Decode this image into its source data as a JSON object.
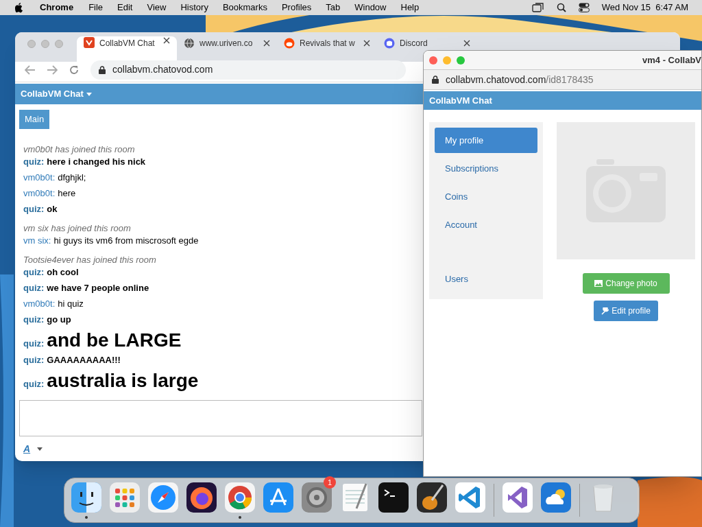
{
  "menu_bar": {
    "app": "Chrome",
    "items": [
      "File",
      "Edit",
      "View",
      "History",
      "Bookmarks",
      "Profiles",
      "Tab",
      "Window",
      "Help"
    ],
    "clock": "Wed Nov 15  6:47 AM"
  },
  "browser": {
    "tabs": [
      {
        "title": "CollabVM Chat",
        "selected": true,
        "kind": "collabvm"
      },
      {
        "title": "www.uriven.co",
        "selected": false,
        "kind": "globe"
      },
      {
        "title": "Revivals that w",
        "selected": false,
        "kind": "reddit"
      },
      {
        "title": "Discord",
        "selected": false,
        "kind": "discord"
      }
    ],
    "url": "collabvm.chatovod.com"
  },
  "chat": {
    "title": "CollabVM Chat",
    "room_tab": "Main",
    "messages": [
      {
        "kind": "system",
        "text": "vm0b0t has joined this room"
      },
      {
        "kind": "chat",
        "user": "quiz:",
        "text": "here i changed his nick",
        "bold": true,
        "large": false
      },
      {
        "kind": "chat",
        "user": "vm0b0t:",
        "text": "dfghjkl;",
        "bold": false,
        "large": false
      },
      {
        "kind": "chat",
        "user": "vm0b0t:",
        "text": "here",
        "bold": false,
        "large": false
      },
      {
        "kind": "chat",
        "user": "quiz:",
        "text": "ok",
        "bold": true,
        "large": false
      },
      {
        "kind": "system",
        "text": "vm six has joined this room"
      },
      {
        "kind": "chat",
        "user": "vm six:",
        "text": "hi guys its vm6 from miscrosoft egde",
        "bold": false,
        "large": false
      },
      {
        "kind": "system",
        "text": "Tootsie4ever has joined this room"
      },
      {
        "kind": "chat",
        "user": "quiz:",
        "text": "oh cool",
        "bold": true,
        "large": false
      },
      {
        "kind": "chat",
        "user": "quiz:",
        "text": "we have 7 people online",
        "bold": true,
        "large": false
      },
      {
        "kind": "chat",
        "user": "vm0b0t:",
        "text": "hi quiz",
        "bold": false,
        "large": false
      },
      {
        "kind": "chat",
        "user": "quiz:",
        "text": "go up",
        "bold": true,
        "large": false
      },
      {
        "kind": "chat",
        "user": "quiz:",
        "text": "and be LARGE",
        "bold": true,
        "large": true
      },
      {
        "kind": "chat",
        "user": "quiz:",
        "text": "GAAAAAAAAA!!!",
        "bold": true,
        "large": false
      },
      {
        "kind": "chat",
        "user": "quiz:",
        "text": "australia is large",
        "bold": true,
        "large": true
      }
    ],
    "font_button": "A"
  },
  "popup": {
    "title": "vm4 - CollabV",
    "url_host": "collabvm.chatovod.com",
    "url_path": "/id8178435",
    "header": "CollabVM Chat",
    "sidebar": {
      "groups": [
        [
          {
            "label": "My profile",
            "selected": true
          },
          {
            "label": "Subscriptions",
            "selected": false
          },
          {
            "label": "Coins",
            "selected": false
          },
          {
            "label": "Account",
            "selected": false
          }
        ],
        [
          {
            "label": "Users",
            "selected": false
          }
        ]
      ]
    },
    "change_photo": "Change photo",
    "edit_profile": "Edit profile"
  },
  "dock": [
    {
      "kind": "finder",
      "running": true
    },
    {
      "kind": "launchpad",
      "running": false
    },
    {
      "kind": "safari",
      "running": false
    },
    {
      "kind": "firefox",
      "running": false
    },
    {
      "kind": "chrome",
      "running": true
    },
    {
      "kind": "appstore",
      "running": false
    },
    {
      "kind": "settings",
      "running": false,
      "badge": "1"
    },
    {
      "kind": "textedit",
      "running": false
    },
    {
      "kind": "terminal",
      "running": false
    },
    {
      "kind": "garageband",
      "running": false
    },
    {
      "kind": "vscode",
      "running": false
    },
    {
      "kind": "separator"
    },
    {
      "kind": "visualstudio",
      "running": false
    },
    {
      "kind": "weather",
      "running": false
    },
    {
      "kind": "separator"
    },
    {
      "kind": "trash",
      "running": false
    }
  ]
}
